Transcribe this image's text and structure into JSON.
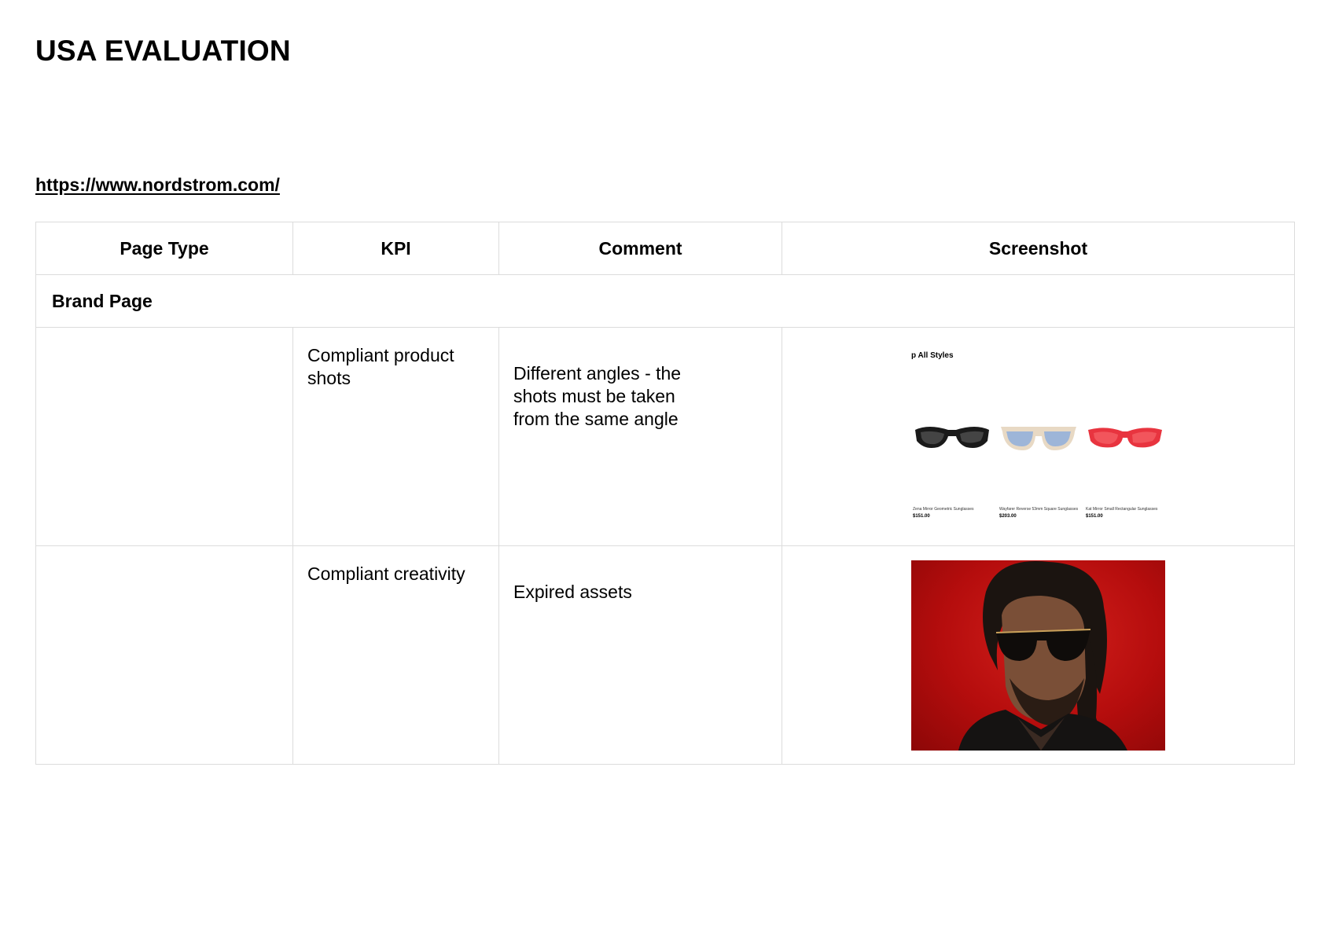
{
  "title": "USA EVALUATION",
  "link": "https://www.nordstrom.com/",
  "table": {
    "headers": [
      "Page Type",
      "KPI",
      "Comment",
      "Screenshot"
    ],
    "section": "Brand Page",
    "rows": [
      {
        "page_type": "",
        "kpi": "Compliant product shots",
        "comment": "Different angles - the shots must be taken from the same angle",
        "screenshot": {
          "heading": "p All Styles",
          "products": [
            {
              "name": "Zena Mirror Geometric Sunglasses",
              "price": "$151.00",
              "color": "#1a1a1a",
              "lens": "#444444"
            },
            {
              "name": "Wayfarer Reverse 53mm Square Sunglasses",
              "price": "$203.00",
              "color": "#e8d9c4",
              "lens": "#9db5d8"
            },
            {
              "name": "Kat Mirror Small Rectangular Sunglasses",
              "price": "$151.00",
              "color": "#e8343f",
              "lens": "#f2555c"
            }
          ]
        }
      },
      {
        "page_type": "",
        "kpi": "Compliant creativity",
        "comment": "Expired assets",
        "screenshot": {
          "type": "portrait-photo",
          "background": "#c8140f"
        }
      }
    ]
  }
}
